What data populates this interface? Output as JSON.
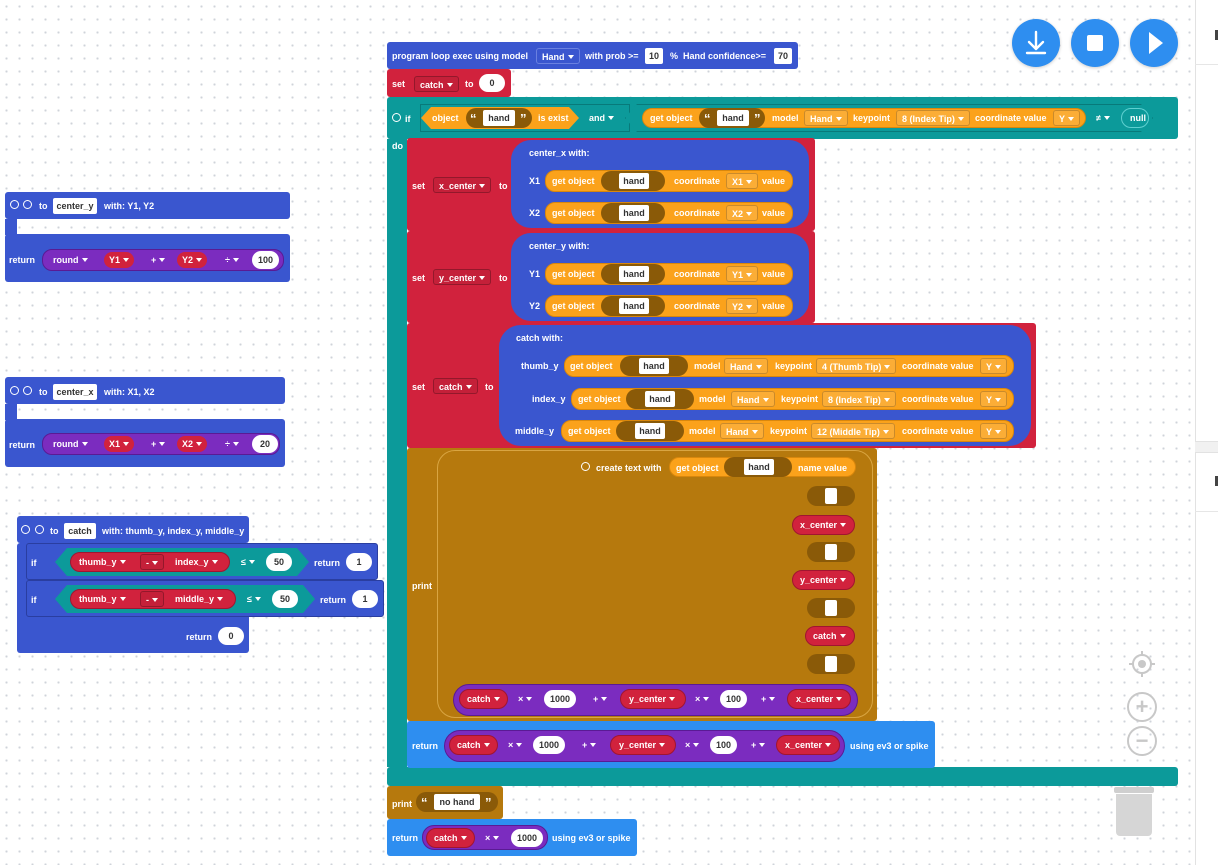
{
  "toolbar": {
    "download_icon": "download-icon",
    "stop_icon": "stop-icon",
    "run_icon": "play-icon"
  },
  "colors": {
    "blue": "#3a56cf",
    "red": "#d1223d",
    "teal": "#0c9a9a",
    "gold": "#b6790d",
    "orange": "#fba21b",
    "purple": "#7b2cbf",
    "light_blue": "#2e8ef0"
  },
  "loop": {
    "text1": "program loop exec using model",
    "model": "Hand",
    "text2": "with prob >=",
    "prob": "10",
    "text3": "%",
    "text4": "Hand confidence>=",
    "conf": "70"
  },
  "set_catch0": {
    "set": "set",
    "var": "catch",
    "to": "to",
    "val": "0"
  },
  "if_block": {
    "if": "if",
    "object": "object",
    "hand": "hand",
    "is_exist": "is exist",
    "and": "and",
    "get_object": "get object",
    "model": "model",
    "model_val": "Hand",
    "keypoint": "keypoint",
    "kp_val": "8 (Index Tip)",
    "coord": "coordinate value",
    "coord_val": "Y",
    "neq": "≠",
    "null": "null",
    "do": "do"
  },
  "set_x": {
    "set": "set",
    "var": "x_center",
    "to": "to",
    "fn": "center_x  with:",
    "a1": "X1",
    "a2": "X2",
    "get_object": "get object",
    "hand": "hand",
    "coordinate": "coordinate",
    "c1": "X1",
    "c2": "X2",
    "value": "value"
  },
  "set_y": {
    "set": "set",
    "var": "y_center",
    "to": "to",
    "fn": "center_y  with:",
    "a1": "Y1",
    "a2": "Y2",
    "get_object": "get object",
    "hand": "hand",
    "coordinate": "coordinate",
    "c1": "Y1",
    "c2": "Y2",
    "value": "value"
  },
  "set_c": {
    "set": "set",
    "var": "catch",
    "to": "to",
    "fn": "catch  with:",
    "a1": "thumb_y",
    "a2": "index_y",
    "a3": "middle_y",
    "get_object": "get object",
    "hand": "hand",
    "model": "model",
    "model_val": "Hand",
    "keypoint": "keypoint",
    "k1": "4 (Thumb Tip)",
    "k2": "8 (Index Tip)",
    "k3": "12 (Middle Tip)",
    "coord": "coordinate value",
    "cv": "Y"
  },
  "print": {
    "print": "print",
    "create": "create text with",
    "get_object": "get object",
    "hand": "hand",
    "name_value": "name value",
    "v1": "x_center",
    "v2": "y_center",
    "v3": "catch"
  },
  "expr": {
    "catch": "catch",
    "times": "×",
    "k1000": "1000",
    "plus": "+",
    "y_center": "y_center",
    "k100": "100",
    "x_center": "x_center"
  },
  "return_inner": {
    "return": "return",
    "suffix": "using ev3 or spike"
  },
  "print_nohand": {
    "print": "print",
    "text": "no hand"
  },
  "return_bottom": {
    "return": "return",
    "catch": "catch",
    "times": "×",
    "val": "1000",
    "suffix": "using ev3 or spike"
  },
  "fn_center_y": {
    "to": "to",
    "name": "center_y",
    "with": "with: Y1, Y2",
    "return": "return",
    "round": "round",
    "a": "Y1",
    "plus": "+",
    "b": "Y2",
    "div": "÷",
    "d": "100"
  },
  "fn_center_x": {
    "to": "to",
    "name": "center_x",
    "with": "with: X1, X2",
    "return": "return",
    "round": "round",
    "a": "X1",
    "plus": "+",
    "b": "X2",
    "div": "÷",
    "d": "20"
  },
  "fn_catch": {
    "to": "to",
    "name": "catch",
    "with": "with: thumb_y, index_y, middle_y",
    "if": "if",
    "a": "thumb_y",
    "minus": "-",
    "b": "index_y",
    "le": "≤",
    "n": "50",
    "return": "return",
    "r1": "1",
    "b2": "middle_y",
    "r0": "0"
  },
  "zoom": {
    "target": "target-icon",
    "plus": "+",
    "minus": "−"
  }
}
